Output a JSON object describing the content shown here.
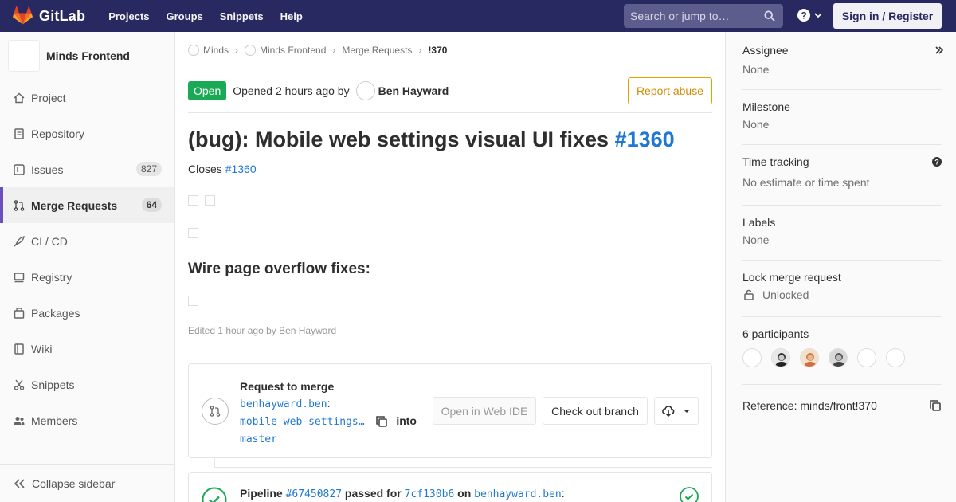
{
  "navbar": {
    "brand": "GitLab",
    "links": [
      "Projects",
      "Groups",
      "Snippets",
      "Help"
    ],
    "search_placeholder": "Search or jump to…",
    "signin_label": "Sign in / Register",
    "colors": {
      "bar": "#292961",
      "logo_orange": "#e24329"
    }
  },
  "sidebar": {
    "project_name": "Minds Frontend",
    "items": [
      {
        "label": "Project",
        "icon": "home-icon"
      },
      {
        "label": "Repository",
        "icon": "doc-icon"
      },
      {
        "label": "Issues",
        "icon": "issues-icon",
        "count": "827"
      },
      {
        "label": "Merge Requests",
        "icon": "merge-request-icon",
        "count": "64",
        "active": true
      },
      {
        "label": "CI / CD",
        "icon": "rocket-icon"
      },
      {
        "label": "Registry",
        "icon": "container-icon"
      },
      {
        "label": "Packages",
        "icon": "package-icon"
      },
      {
        "label": "Wiki",
        "icon": "book-icon"
      },
      {
        "label": "Snippets",
        "icon": "scissors-icon"
      },
      {
        "label": "Members",
        "icon": "users-icon"
      }
    ],
    "collapse_label": "Collapse sidebar"
  },
  "breadcrumb": {
    "items": [
      "Minds",
      "Minds Frontend",
      "Merge Requests",
      "!370"
    ]
  },
  "mr": {
    "status": "Open",
    "opened_text": "Opened 2 hours ago by",
    "author": "Ben Hayward",
    "report_label": "Report abuse",
    "title": "(bug): Mobile web settings visual UI fixes",
    "title_ref": "#1360",
    "closes_label": "Closes",
    "closes_ref": "#1360",
    "heading": "Wire page overflow fixes:",
    "edited": "Edited 1 hour ago by Ben Hayward"
  },
  "widget": {
    "request_label": "Request to merge",
    "source_branch_ns": "benhayward.ben",
    "source_branch": "mobile-web-settings…",
    "into_label": "into",
    "target_branch": "master",
    "web_ide_label": "Open in Web IDE",
    "checkout_label": "Check out branch"
  },
  "pipeline": {
    "label": "Pipeline",
    "id": "#67450827",
    "passed_for": "passed for",
    "commit": "7cf130b6",
    "on": "on",
    "branch": "benhayward.ben",
    "colon": ":"
  },
  "right": {
    "assignee_title": "Assignee",
    "assignee_val": "None",
    "milestone_title": "Milestone",
    "milestone_val": "None",
    "time_title": "Time tracking",
    "time_val": "No estimate or time spent",
    "labels_title": "Labels",
    "labels_val": "None",
    "lock_title": "Lock merge request",
    "lock_val": "Unlocked",
    "participants_title": "6 participants",
    "reference": "Reference: minds/front!370"
  }
}
